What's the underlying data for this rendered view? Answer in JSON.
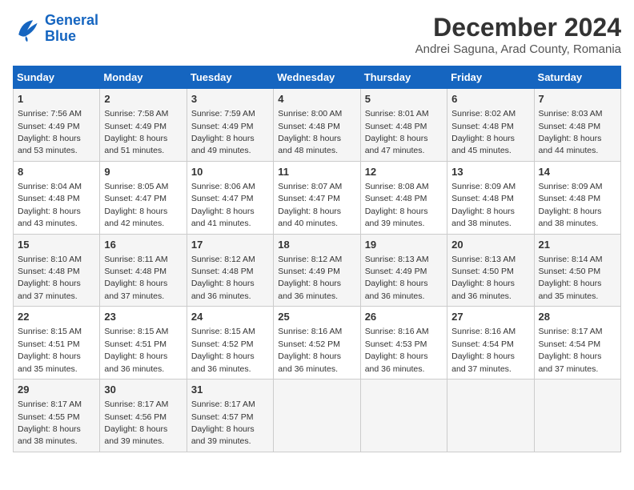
{
  "logo": {
    "line1": "General",
    "line2": "Blue"
  },
  "title": "December 2024",
  "subtitle": "Andrei Saguna, Arad County, Romania",
  "columns": [
    "Sunday",
    "Monday",
    "Tuesday",
    "Wednesday",
    "Thursday",
    "Friday",
    "Saturday"
  ],
  "weeks": [
    [
      {
        "day": "1",
        "info": "Sunrise: 7:56 AM\nSunset: 4:49 PM\nDaylight: 8 hours\nand 53 minutes."
      },
      {
        "day": "2",
        "info": "Sunrise: 7:58 AM\nSunset: 4:49 PM\nDaylight: 8 hours\nand 51 minutes."
      },
      {
        "day": "3",
        "info": "Sunrise: 7:59 AM\nSunset: 4:49 PM\nDaylight: 8 hours\nand 49 minutes."
      },
      {
        "day": "4",
        "info": "Sunrise: 8:00 AM\nSunset: 4:48 PM\nDaylight: 8 hours\nand 48 minutes."
      },
      {
        "day": "5",
        "info": "Sunrise: 8:01 AM\nSunset: 4:48 PM\nDaylight: 8 hours\nand 47 minutes."
      },
      {
        "day": "6",
        "info": "Sunrise: 8:02 AM\nSunset: 4:48 PM\nDaylight: 8 hours\nand 45 minutes."
      },
      {
        "day": "7",
        "info": "Sunrise: 8:03 AM\nSunset: 4:48 PM\nDaylight: 8 hours\nand 44 minutes."
      }
    ],
    [
      {
        "day": "8",
        "info": "Sunrise: 8:04 AM\nSunset: 4:48 PM\nDaylight: 8 hours\nand 43 minutes."
      },
      {
        "day": "9",
        "info": "Sunrise: 8:05 AM\nSunset: 4:47 PM\nDaylight: 8 hours\nand 42 minutes."
      },
      {
        "day": "10",
        "info": "Sunrise: 8:06 AM\nSunset: 4:47 PM\nDaylight: 8 hours\nand 41 minutes."
      },
      {
        "day": "11",
        "info": "Sunrise: 8:07 AM\nSunset: 4:47 PM\nDaylight: 8 hours\nand 40 minutes."
      },
      {
        "day": "12",
        "info": "Sunrise: 8:08 AM\nSunset: 4:48 PM\nDaylight: 8 hours\nand 39 minutes."
      },
      {
        "day": "13",
        "info": "Sunrise: 8:09 AM\nSunset: 4:48 PM\nDaylight: 8 hours\nand 38 minutes."
      },
      {
        "day": "14",
        "info": "Sunrise: 8:09 AM\nSunset: 4:48 PM\nDaylight: 8 hours\nand 38 minutes."
      }
    ],
    [
      {
        "day": "15",
        "info": "Sunrise: 8:10 AM\nSunset: 4:48 PM\nDaylight: 8 hours\nand 37 minutes."
      },
      {
        "day": "16",
        "info": "Sunrise: 8:11 AM\nSunset: 4:48 PM\nDaylight: 8 hours\nand 37 minutes."
      },
      {
        "day": "17",
        "info": "Sunrise: 8:12 AM\nSunset: 4:48 PM\nDaylight: 8 hours\nand 36 minutes."
      },
      {
        "day": "18",
        "info": "Sunrise: 8:12 AM\nSunset: 4:49 PM\nDaylight: 8 hours\nand 36 minutes."
      },
      {
        "day": "19",
        "info": "Sunrise: 8:13 AM\nSunset: 4:49 PM\nDaylight: 8 hours\nand 36 minutes."
      },
      {
        "day": "20",
        "info": "Sunrise: 8:13 AM\nSunset: 4:50 PM\nDaylight: 8 hours\nand 36 minutes."
      },
      {
        "day": "21",
        "info": "Sunrise: 8:14 AM\nSunset: 4:50 PM\nDaylight: 8 hours\nand 35 minutes."
      }
    ],
    [
      {
        "day": "22",
        "info": "Sunrise: 8:15 AM\nSunset: 4:51 PM\nDaylight: 8 hours\nand 35 minutes."
      },
      {
        "day": "23",
        "info": "Sunrise: 8:15 AM\nSunset: 4:51 PM\nDaylight: 8 hours\nand 36 minutes."
      },
      {
        "day": "24",
        "info": "Sunrise: 8:15 AM\nSunset: 4:52 PM\nDaylight: 8 hours\nand 36 minutes."
      },
      {
        "day": "25",
        "info": "Sunrise: 8:16 AM\nSunset: 4:52 PM\nDaylight: 8 hours\nand 36 minutes."
      },
      {
        "day": "26",
        "info": "Sunrise: 8:16 AM\nSunset: 4:53 PM\nDaylight: 8 hours\nand 36 minutes."
      },
      {
        "day": "27",
        "info": "Sunrise: 8:16 AM\nSunset: 4:54 PM\nDaylight: 8 hours\nand 37 minutes."
      },
      {
        "day": "28",
        "info": "Sunrise: 8:17 AM\nSunset: 4:54 PM\nDaylight: 8 hours\nand 37 minutes."
      }
    ],
    [
      {
        "day": "29",
        "info": "Sunrise: 8:17 AM\nSunset: 4:55 PM\nDaylight: 8 hours\nand 38 minutes."
      },
      {
        "day": "30",
        "info": "Sunrise: 8:17 AM\nSunset: 4:56 PM\nDaylight: 8 hours\nand 39 minutes."
      },
      {
        "day": "31",
        "info": "Sunrise: 8:17 AM\nSunset: 4:57 PM\nDaylight: 8 hours\nand 39 minutes."
      },
      {
        "day": "",
        "info": ""
      },
      {
        "day": "",
        "info": ""
      },
      {
        "day": "",
        "info": ""
      },
      {
        "day": "",
        "info": ""
      }
    ]
  ]
}
